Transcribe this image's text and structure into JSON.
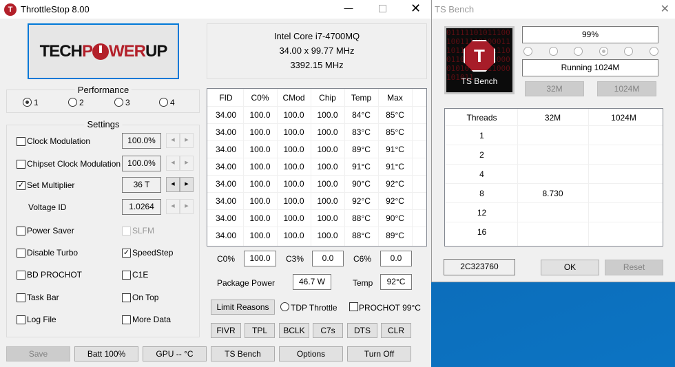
{
  "main": {
    "title": "ThrottleStop 8.00",
    "logo_text": "TECHPOWERUP",
    "cpu": {
      "name": "Intel Core i7-4700MQ",
      "bus": "34.00 x 99.77 MHz",
      "freq": "3392.15 MHz"
    },
    "performance": {
      "label": "Performance",
      "options": [
        "1",
        "2",
        "3",
        "4"
      ],
      "selected": 0
    },
    "settings": {
      "label": "Settings",
      "clock_modulation": {
        "label": "Clock Modulation",
        "value": "100.0%",
        "checked": false
      },
      "chipset_clock_modulation": {
        "label": "Chipset Clock Modulation",
        "value": "100.0%",
        "checked": false
      },
      "set_multiplier": {
        "label": "Set Multiplier",
        "value": "36 T",
        "checked": true
      },
      "voltage_id": {
        "label": "Voltage ID",
        "value": "1.0264"
      },
      "power_saver": {
        "label": "Power Saver",
        "checked": false
      },
      "slfm": {
        "label": "SLFM",
        "checked": false
      },
      "disable_turbo": {
        "label": "Disable Turbo",
        "checked": false
      },
      "speedstep": {
        "label": "SpeedStep",
        "checked": true
      },
      "bd_prochot": {
        "label": "BD PROCHOT",
        "checked": false
      },
      "c1e": {
        "label": "C1E",
        "checked": false
      },
      "task_bar": {
        "label": "Task Bar",
        "checked": false
      },
      "on_top": {
        "label": "On Top",
        "checked": false
      },
      "log_file": {
        "label": "Log File",
        "checked": false
      },
      "more_data": {
        "label": "More Data",
        "checked": false
      }
    },
    "table": {
      "headers": [
        "FID",
        "C0%",
        "CMod",
        "Chip",
        "Temp",
        "Max"
      ],
      "rows": [
        [
          "34.00",
          "100.0",
          "100.0",
          "100.0",
          "84°C",
          "85°C"
        ],
        [
          "34.00",
          "100.0",
          "100.0",
          "100.0",
          "83°C",
          "85°C"
        ],
        [
          "34.00",
          "100.0",
          "100.0",
          "100.0",
          "89°C",
          "91°C"
        ],
        [
          "34.00",
          "100.0",
          "100.0",
          "100.0",
          "91°C",
          "91°C"
        ],
        [
          "34.00",
          "100.0",
          "100.0",
          "100.0",
          "90°C",
          "92°C"
        ],
        [
          "34.00",
          "100.0",
          "100.0",
          "100.0",
          "92°C",
          "92°C"
        ],
        [
          "34.00",
          "100.0",
          "100.0",
          "100.0",
          "88°C",
          "90°C"
        ],
        [
          "34.00",
          "100.0",
          "100.0",
          "100.0",
          "88°C",
          "89°C"
        ]
      ]
    },
    "cstates": {
      "c0_label": "C0%",
      "c0": "100.0",
      "c3_label": "C3%",
      "c3": "0.0",
      "c6_label": "C6%",
      "c6": "0.0"
    },
    "package_power": {
      "label": "Package Power",
      "value": "46.7 W",
      "temp_label": "Temp",
      "temp": "92°C"
    },
    "limit_reasons": "Limit Reasons",
    "tdp_throttle": "TDP Throttle",
    "prochot": "PROCHOT 99°C",
    "tool_buttons": [
      "FIVR",
      "TPL",
      "BCLK",
      "C7s",
      "DTS",
      "CLR"
    ],
    "bottom_buttons": [
      "Save",
      "Batt 100%",
      "GPU -- °C",
      "TS Bench",
      "Options",
      "Turn Off"
    ]
  },
  "bench": {
    "title": "TS Bench",
    "image_label": "TS Bench",
    "progress": "99%",
    "status": "Running 1024M",
    "radio_selected": 3,
    "btn_32m": "32M",
    "btn_1024m": "1024M",
    "table": {
      "headers": [
        "Threads",
        "32M",
        "1024M"
      ],
      "rows": [
        [
          "1",
          "",
          ""
        ],
        [
          "2",
          "",
          ""
        ],
        [
          "4",
          "",
          ""
        ],
        [
          "8",
          "8.730",
          ""
        ],
        [
          "12",
          "",
          ""
        ],
        [
          "16",
          "",
          ""
        ]
      ]
    },
    "code": "2C323760",
    "ok": "OK",
    "reset": "Reset"
  }
}
